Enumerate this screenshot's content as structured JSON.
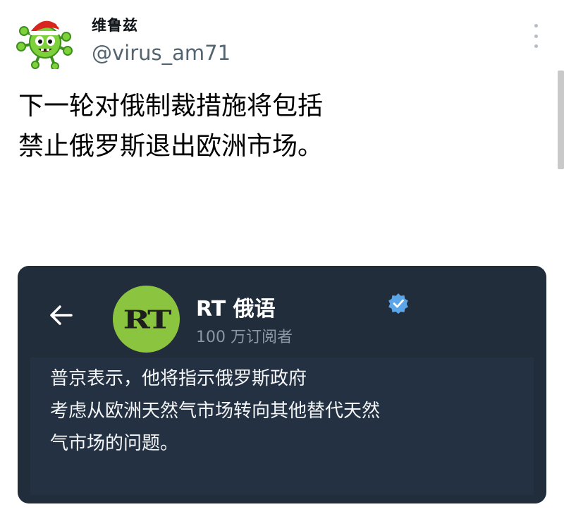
{
  "tweet": {
    "display_name": "维鲁兹",
    "handle": "@virus_am71",
    "text_lines": [
      "下一轮对俄制裁措施将包括",
      "禁止俄罗斯退出欧洲市场。"
    ]
  },
  "embed": {
    "channel_name": "RT 俄语",
    "subscribers": "100 万订阅者",
    "logo_text": "RT",
    "message_lines": [
      "普京表示，他将指示俄罗斯政府",
      "考虑从欧洲天然气市场转向其他替代天然",
      "气市场的问题。"
    ]
  },
  "icons": {
    "avatar": "green-virus-santa-hat-avatar-icon",
    "more": "more-vertical-icon",
    "back": "arrow-left-icon",
    "verified": "verified-badge-icon"
  },
  "colors": {
    "card_bg": "#222d3b",
    "rt_green": "#8bc53f",
    "verified": "#5aa6e8",
    "handle": "#536471"
  }
}
